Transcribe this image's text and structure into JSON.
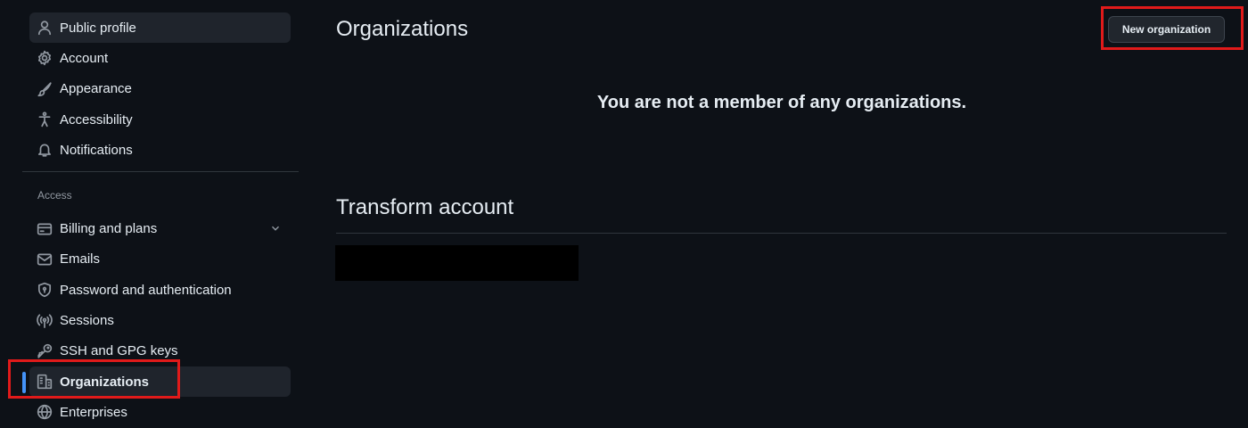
{
  "sidebar": {
    "items": [
      {
        "label": "Public profile",
        "icon": "person-icon"
      },
      {
        "label": "Account",
        "icon": "gear-icon"
      },
      {
        "label": "Appearance",
        "icon": "paintbrush-icon"
      },
      {
        "label": "Accessibility",
        "icon": "accessibility-icon"
      },
      {
        "label": "Notifications",
        "icon": "bell-icon"
      }
    ],
    "access_heading": "Access",
    "access_items": [
      {
        "label": "Billing and plans",
        "icon": "credit-card-icon",
        "expandable": true
      },
      {
        "label": "Emails",
        "icon": "mail-icon"
      },
      {
        "label": "Password and authentication",
        "icon": "shield-lock-icon"
      },
      {
        "label": "Sessions",
        "icon": "broadcast-icon"
      },
      {
        "label": "SSH and GPG keys",
        "icon": "key-icon"
      },
      {
        "label": "Organizations",
        "icon": "organization-icon",
        "active": true
      },
      {
        "label": "Enterprises",
        "icon": "globe-icon"
      }
    ]
  },
  "main": {
    "title": "Organizations",
    "new_org_button": "New organization",
    "empty_message": "You are not a member of any organizations.",
    "transform_title": "Transform account"
  },
  "colors": {
    "background": "#0d1117",
    "active_indicator": "#4493f8",
    "highlight": "#e01a1a"
  }
}
